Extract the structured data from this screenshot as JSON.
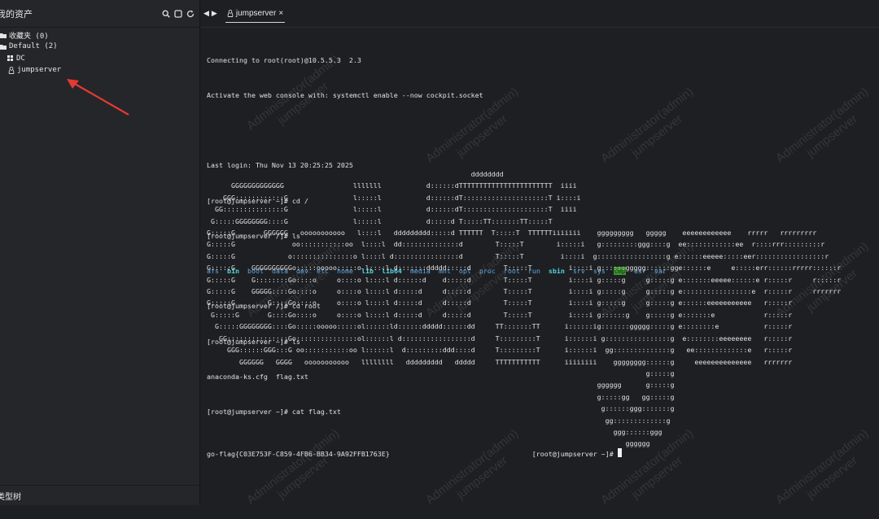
{
  "sidebar": {
    "title": "我的资产",
    "footer_label": "类型树",
    "tree": [
      {
        "label": "收藏夹 (0)",
        "icon": "folder-icon"
      },
      {
        "label": "Default (2)",
        "icon": "folder-icon"
      },
      {
        "label": "DC",
        "icon": "grid-icon"
      },
      {
        "label": "jumpserver",
        "icon": "linux-icon"
      }
    ]
  },
  "tab": {
    "label": "jumpserver",
    "close": "×"
  },
  "terminal": {
    "lines": [
      "Connecting to root(root)@10.5.5.3  2.3",
      "Activate the web console with: systemctl enable --now cockpit.socket",
      "",
      "Last login: Thu Nov 13 20:25:25 2025",
      "[root@jumpserver ~]# cd /",
      "[root@jumpserver /]# ls"
    ],
    "ls_items": [
      {
        "name": "afs",
        "kind": "dir"
      },
      {
        "name": "bin",
        "kind": "lnk"
      },
      {
        "name": "boot",
        "kind": "dir"
      },
      {
        "name": "data",
        "kind": "dir"
      },
      {
        "name": "dev",
        "kind": "dir"
      },
      {
        "name": "etc",
        "kind": "dir"
      },
      {
        "name": "home",
        "kind": "dir"
      },
      {
        "name": "lib",
        "kind": "lnk"
      },
      {
        "name": "lib64",
        "kind": "lnk"
      },
      {
        "name": "media",
        "kind": "dir"
      },
      {
        "name": "mnt",
        "kind": "dir"
      },
      {
        "name": "opt",
        "kind": "dir"
      },
      {
        "name": "proc",
        "kind": "dir"
      },
      {
        "name": "root",
        "kind": "dir"
      },
      {
        "name": "run",
        "kind": "dir"
      },
      {
        "name": "sbin",
        "kind": "lnk"
      },
      {
        "name": "srv",
        "kind": "dir"
      },
      {
        "name": "sys",
        "kind": "dir"
      },
      {
        "name": "tmp",
        "kind": "tmp"
      },
      {
        "name": "usr",
        "kind": "dir"
      },
      {
        "name": "var",
        "kind": "dir"
      }
    ],
    "lines_after": [
      "[root@jumpserver /]# cd root",
      "[root@jumpserver ~]# ls",
      "anaconda-ks.cfg  flag.txt",
      "[root@jumpserver ~]# cat flag.txt"
    ],
    "ascii_art": [
      "                                                                 dddddddd",
      "      GGGGGGGGGGGGG                 lllllll           d::::::dTTTTTTTTTTTTTTTTTTTTTTT  iiii",
      "    GGG::::::::::::G                l:::::l           d::::::dT:::::::::::::::::::::T i::::i",
      "  GG:::::::::::::::G                l:::::l           d::::::dT:::::::::::::::::::::T  iiii",
      " G:::::GGGGGGGG::::G                l:::::l           d:::::d T:::::TT:::::::TT:::::T",
      "G:::::G       GGGGGG   ooooooooooo   l::::l   ddddddddd:::::d TTTTTT  T:::::T  TTTTTTiiiiiii    ggggggggg   ggggg    eeeeeeeeeeee    rrrrr   rrrrrrrrr",
      "G:::::G              oo:::::::::::oo  l::::l  dd::::::::::::::d        T:::::T        i:::::i   g:::::::::ggg::::g  ee::::::::::::ee  r::::rrr:::::::::r",
      "G:::::G             o:::::::::::::::o l::::l d::::::::::::::::d        T:::::T         i::::i  g:::::::::::::::::g e::::::eeeee:::::eer:::::::::::::::::r",
      "G:::::G    GGGGGGGGGGo:::::ooooo:::::o l::::l d:::::::ddddd:::::d        T:::::T         i::::i g::::::ggggg::::::gge::::::e     e:::::err::::::rrrrr::::::r",
      "G:::::G    G::::::::Go::::o     o::::o l::::l d::::::d    d:::::d        T:::::T         i::::i g:::::g     g:::::g e:::::::eeeee::::::e r:::::r     r:::::r",
      "G:::::G    GGGGG::::Go::::o     o::::o l::::l d:::::d     d:::::d        T:::::T         i::::i g:::::g     g:::::g e:::::::::::::::::e  r:::::r     rrrrrrr",
      "G:::::G        G::::Go::::o     o::::o l::::l d:::::d     d:::::d        T:::::T         i::::i g:::::g     g:::::g e::::::eeeeeeeeeee   r:::::r",
      " G:::::G       G::::Go::::o     o::::o l::::l d:::::d     d:::::d        T:::::T         i::::i g::::::g    g:::::g e:::::::e            r:::::r",
      "  G:::::GGGGGGGG::::Go:::::ooooo:::::ol::::::ld::::::ddddd::::::dd     TT:::::::TT      i::::::ig:::::::ggggg:::::g e::::::::e           r:::::r",
      "   GG:::::::::::::::Go:::::::::::::::ol::::::l d:::::::::::::::::d     T:::::::::T      i::::::i g::::::::::::::::g  e::::::::eeeeeeee   r:::::r",
      "     GGG::::::GGG:::G oo:::::::::::oo l::::::l  d:::::::::ddd::::d     T:::::::::T      i::::::i  gg::::::::::::::g   ee:::::::::::::e   r:::::r",
      "        GGGGGG   GGGG   ooooooooooo   llllllll   ddddddddd   ddddd     TTTTTTTTTTT      iiiiiiii    gggggggg::::::g     eeeeeeeeeeeeee   rrrrrrr",
      "                                                                                                            g:::::g",
      "                                                                                                gggggg      g:::::g",
      "                                                                                                g:::::gg   gg:::::g",
      "                                                                                                 g::::::ggg:::::::g",
      "                                                                                                  gg:::::::::::::g",
      "                                                                                                    ggg::::::ggg",
      "                                                                                                       gggggg"
    ],
    "flag": "go-flag{C03E753F-C859-4FB6-BB34-9A92FFB1763E}",
    "final_prompt": "[root@jumpserver ~]#"
  },
  "watermark": {
    "line1": "Administrator(admin)",
    "line2": "jumpserver"
  },
  "colors": {
    "dir": "#5aa8e8",
    "link": "#4fd4e0",
    "tmp_bg": "#3a9a2c",
    "arrow": "#e53935"
  }
}
